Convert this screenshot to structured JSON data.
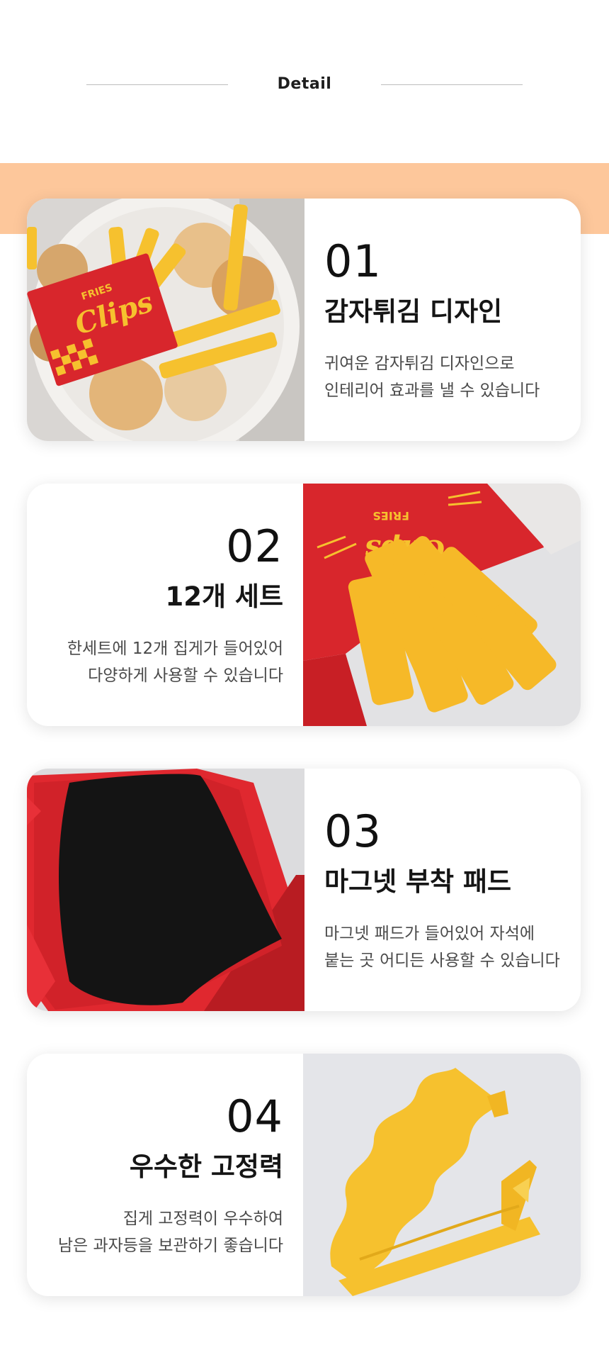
{
  "header": {
    "title": "Detail"
  },
  "colors": {
    "accent_band": "#fdc79b",
    "fries_red": "#d8262c",
    "fries_yellow": "#f6c12e"
  },
  "features": [
    {
      "number": "01",
      "title": "감자튀김 디자인",
      "desc": [
        "귀여운 감자튀김  디자인으로",
        "인테리어 효과를 낼 수 있습니다"
      ],
      "image": "fries-clips-on-plate-photo"
    },
    {
      "number": "02",
      "title": "12개 세트",
      "desc": [
        "한세트에 12개 집게가 들어있어",
        "다양하게 사용할 수 있습니다"
      ],
      "image": "fries-box-closeup-photo"
    },
    {
      "number": "03",
      "title": "마그넷 부착 패드",
      "desc": [
        "마그넷  패드가 들어있어 자석에",
        "붙는 곳 어디든 사용할 수 있습니다"
      ],
      "image": "magnet-pad-back-photo"
    },
    {
      "number": "04",
      "title": "우수한 고정력",
      "desc": [
        "집게 고정력이 우수하여",
        "남은 과자등을 보관하기 좋습니다"
      ],
      "image": "clip-hinge-closeup-photo"
    }
  ],
  "box_print": {
    "brand": "Clips",
    "label": "FRIES"
  }
}
